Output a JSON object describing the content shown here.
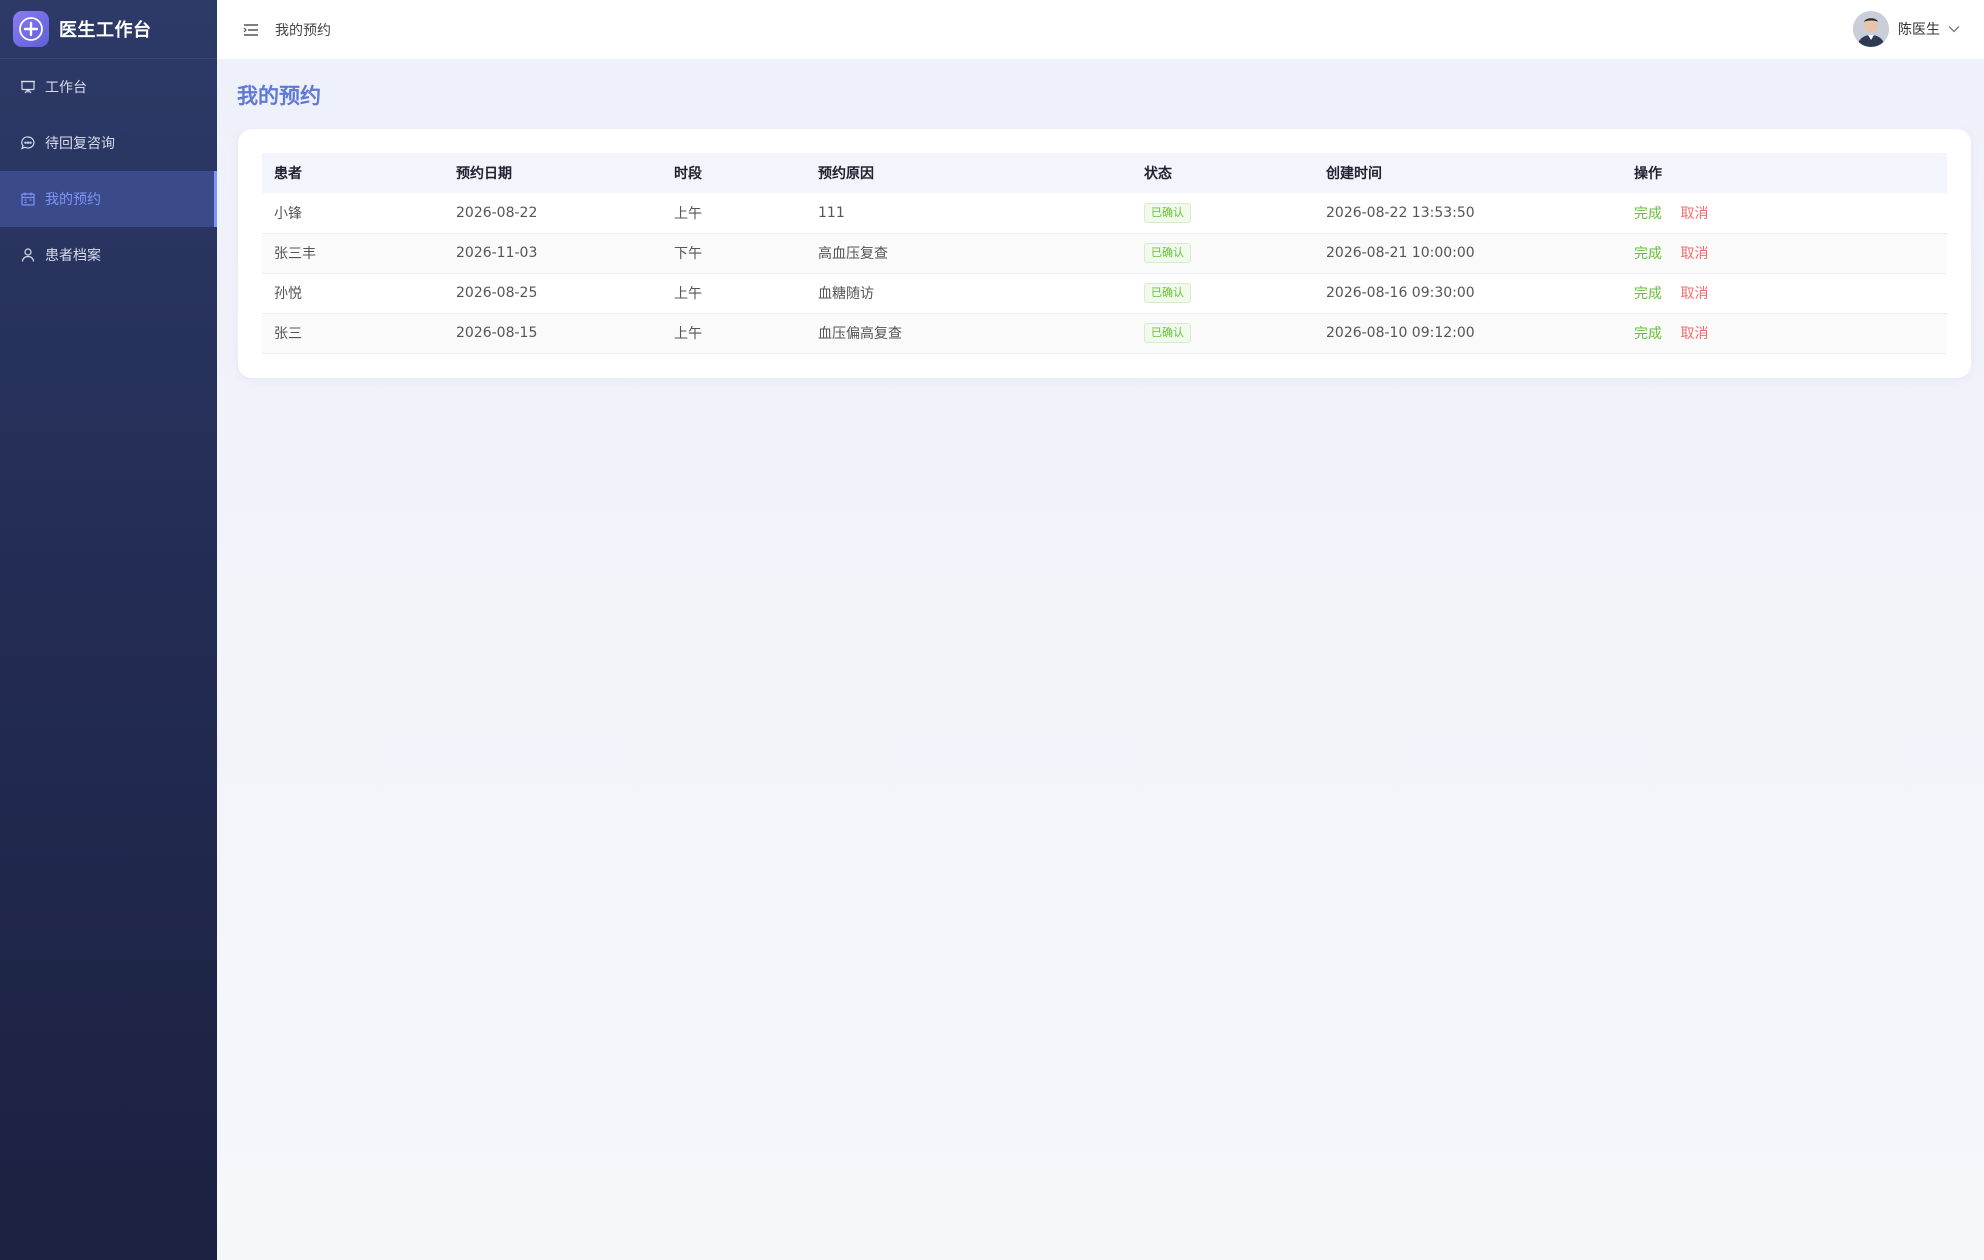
{
  "brand": {
    "name": "医生工作台",
    "logo_icon": "plus-icon"
  },
  "sidebar": {
    "items": [
      {
        "label": "工作台",
        "icon": "presentation-board-icon",
        "active": false
      },
      {
        "label": "待回复咨询",
        "icon": "chat-bubble-icon",
        "active": false
      },
      {
        "label": "我的预约",
        "icon": "calendar-icon",
        "active": true
      },
      {
        "label": "患者档案",
        "icon": "user-icon",
        "active": false
      }
    ]
  },
  "header": {
    "breadcrumb": "我的预约",
    "user_name": "陈医生"
  },
  "page": {
    "title": "我的预约"
  },
  "table": {
    "columns": [
      "患者",
      "预约日期",
      "时段",
      "预约原因",
      "状态",
      "创建时间",
      "操作"
    ],
    "rows": [
      {
        "patient": "小锋",
        "date": "2026-08-22",
        "period": "上午",
        "reason": "111",
        "status": "已确认",
        "created": "2026-08-22 13:53:50",
        "complete": "完成",
        "cancel": "取消"
      },
      {
        "patient": "张三丰",
        "date": "2026-11-03",
        "period": "下午",
        "reason": "高血压复查",
        "status": "已确认",
        "created": "2026-08-21 10:00:00",
        "complete": "完成",
        "cancel": "取消"
      },
      {
        "patient": "孙悦",
        "date": "2026-08-25",
        "period": "上午",
        "reason": "血糖随访",
        "status": "已确认",
        "created": "2026-08-16 09:30:00",
        "complete": "完成",
        "cancel": "取消"
      },
      {
        "patient": "张三",
        "date": "2026-08-15",
        "period": "上午",
        "reason": "血压偏高复查",
        "status": "已确认",
        "created": "2026-08-10 09:12:00",
        "complete": "完成",
        "cancel": "取消"
      }
    ]
  },
  "colors": {
    "accent": "#6079d6",
    "success": "#67c23a",
    "danger": "#f56c6c",
    "sidebar_bg": "#222b52"
  }
}
